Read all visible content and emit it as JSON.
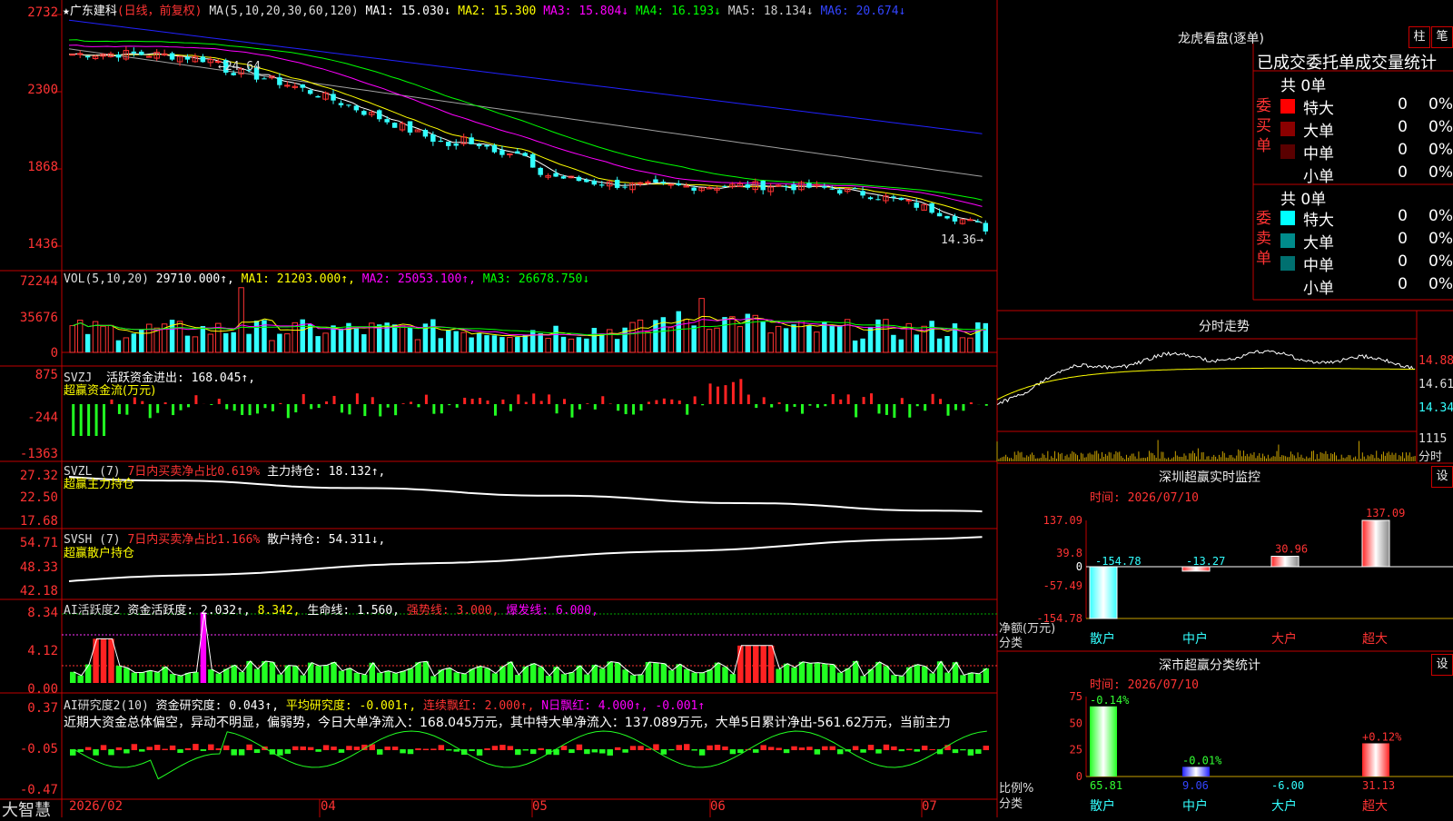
{
  "header": {
    "stock_name": "★广东建科",
    "mode": "(日线，前复权)",
    "ma_label": "MA(5,10,20,30,60,120)",
    "ma1": "MA1: 15.030↓",
    "ma2": "MA2: 15.300",
    "ma3": "MA3: 15.804↓",
    "ma4": "MA4: 16.193↓",
    "ma5": "MA5: 18.134↓",
    "ma6": "MA6: 20.674↓",
    "high_mark": "24.64",
    "low_mark": "14.36"
  },
  "price_axis": [
    "2732",
    "2300",
    "1868",
    "1436"
  ],
  "vol": {
    "label": "VOL(5,10,20)",
    "value": "29710.000↑,",
    "ma1": "MA1: 21203.000↑,",
    "ma2": "MA2: 25053.100↑,",
    "ma3": "MA3: 26678.750↓",
    "axis": [
      "72244",
      "35676",
      "0"
    ]
  },
  "svzj": {
    "label": "SVZJ",
    "line": "活跃资金进出: 168.045↑,",
    "sub": "超赢资金流(万元)",
    "axis": [
      "875",
      "-244",
      "-1363"
    ]
  },
  "svzl": {
    "label": "SVZL (7)",
    "line1": "7日内买卖净占比0.619%",
    "line2": "主力持仓: 18.132↑,",
    "sub": "超赢主力持仓",
    "axis": [
      "27.32",
      "22.50",
      "17.68"
    ]
  },
  "svsh": {
    "label": "SVSH (7)",
    "line1": "7日内买卖净占比1.166%",
    "line2": "散户持仓: 54.311↓,",
    "sub": "超赢散户持仓",
    "axis": [
      "54.71",
      "48.33",
      "42.18"
    ]
  },
  "ai_active": {
    "label": "AI活跃度2",
    "line1": "资金活跃度: 2.032↑,",
    "line2": "8.342,",
    "line3": "生命线: 1.560,",
    "line4": "强势线: 3.000,",
    "line5": "爆发线: 6.000,",
    "axis": [
      "8.34",
      "4.12",
      "0.00"
    ]
  },
  "ai_research": {
    "label": "AI研究度2(10)",
    "line1": "资金研究度: 0.043↑,",
    "line2": "平均研究度: -0.001↑,",
    "line3": "连续飘红: 2.000↑,",
    "line4": "N日飘红: 4.000↑,",
    "line5": "-0.001↑",
    "summary": "近期大资金总体偏空，异动不明显，偏弱势，今日大单净流入：168.045万元，其中特大单净流入：137.089万元，大单5日累计净出-561.62万元，当前主力",
    "axis": [
      "0.37",
      "-0.05",
      "-0.47"
    ]
  },
  "xaxis": {
    "brand": "大智慧",
    "labels": [
      "2026/02",
      "04",
      "05",
      "06",
      "07"
    ]
  },
  "lhb": {
    "title": "龙虎看盘(逐单)",
    "btn1": "柱",
    "btn2": "笔",
    "subtitle": "已成交委托单成交量统计",
    "buy_side": "委买单",
    "sell_side": "委卖单",
    "buy_total": "共 0单",
    "sell_total": "共 0单",
    "buy_rows": [
      {
        "label": "特大",
        "count": "0",
        "pct": "0%",
        "color": "#ff0000"
      },
      {
        "label": "大单",
        "count": "0",
        "pct": "0%",
        "color": "#8b0000"
      },
      {
        "label": "中单",
        "count": "0",
        "pct": "0%",
        "color": "#5a0000"
      },
      {
        "label": "小单",
        "count": "0",
        "pct": "0%",
        "color": ""
      }
    ],
    "sell_rows": [
      {
        "label": "特大",
        "count": "0",
        "pct": "0%",
        "color": "#00ffff"
      },
      {
        "label": "大单",
        "count": "0",
        "pct": "0%",
        "color": "#008b8b"
      },
      {
        "label": "中单",
        "count": "0",
        "pct": "0%",
        "color": "#007070"
      },
      {
        "label": "小单",
        "count": "0",
        "pct": "0%",
        "color": ""
      }
    ]
  },
  "intraday": {
    "title": "分时走势",
    "axis": [
      "14.88",
      "14.61",
      "14.34"
    ],
    "vol_axis": "1115",
    "vol_unit": "分时"
  },
  "sz_monitor": {
    "title": "深圳超赢实时监控",
    "btn": "设",
    "time": "时间: 2026/07/10",
    "axis": [
      "137.09",
      "39.8",
      "0",
      "-57.49",
      "-154.78"
    ],
    "y_title": "净额(万元)",
    "x_title": "分类",
    "categories": [
      "散户",
      "中户",
      "大户",
      "超大"
    ],
    "values": [
      -154.78,
      -13.27,
      30.96,
      137.09
    ],
    "value_labels": [
      "-154.78",
      "-13.27",
      "30.96",
      "137.09"
    ]
  },
  "sz_stats": {
    "title": "深市超赢分类统计",
    "btn": "设",
    "time": "时间: 2026/07/10",
    "axis": [
      "75",
      "50",
      "25",
      "0"
    ],
    "y_title": "比例%",
    "x_title": "分类",
    "categories": [
      "散户",
      "中户",
      "大户",
      "超大"
    ],
    "values": [
      65.81,
      9.06,
      -6.0,
      31.13
    ],
    "value_labels": [
      "65.81",
      "9.06",
      "-6.00",
      "31.13"
    ],
    "changes": [
      "-0.14%",
      "-0.01%",
      "",
      "+0.12%"
    ]
  },
  "colors": {
    "up": "#ff3333",
    "down": "#33ffff",
    "grid": "#b00000",
    "ma_white": "#ffffff",
    "ma_yellow": "#ffff00",
    "ma_magenta": "#ff00ff",
    "ma_green": "#00ff00",
    "ma_gray": "#a0a0a0",
    "ma_blue": "#2222ff"
  }
}
